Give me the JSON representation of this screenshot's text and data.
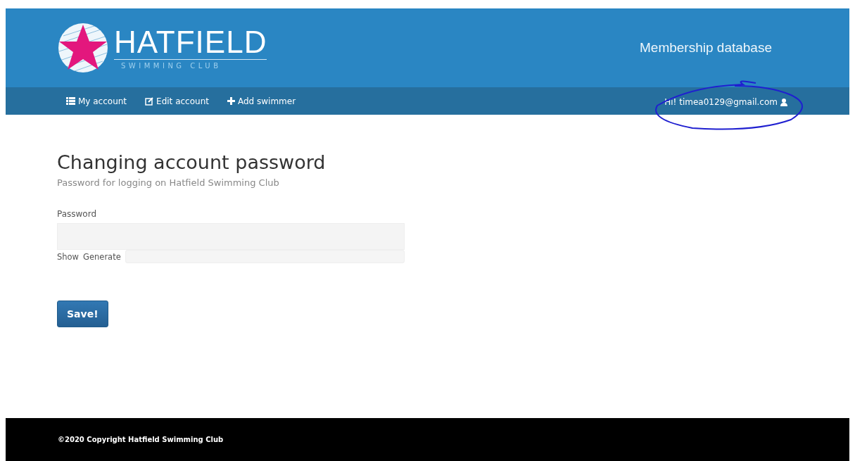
{
  "header": {
    "logo": {
      "name": "HATFIELD",
      "tagline": "SWIMMING CLUB"
    },
    "title": "Membership database"
  },
  "nav": {
    "items": [
      {
        "kind": "list",
        "label": "My account"
      },
      {
        "kind": "edit",
        "label": "Edit account"
      },
      {
        "kind": "add",
        "label": "Add swimmer"
      }
    ],
    "user": "Hi! timea0129@gmail.com",
    "annotated": true
  },
  "form": {
    "heading": "Changing account password",
    "subheading": "Password for logging on Hatfield Swimming Club",
    "field_label": "Password",
    "links": [
      "Show",
      "Generate"
    ],
    "submit": "Save!"
  },
  "footer": {
    "text": "©2020 Copyright Hatfield Swimming Club"
  }
}
